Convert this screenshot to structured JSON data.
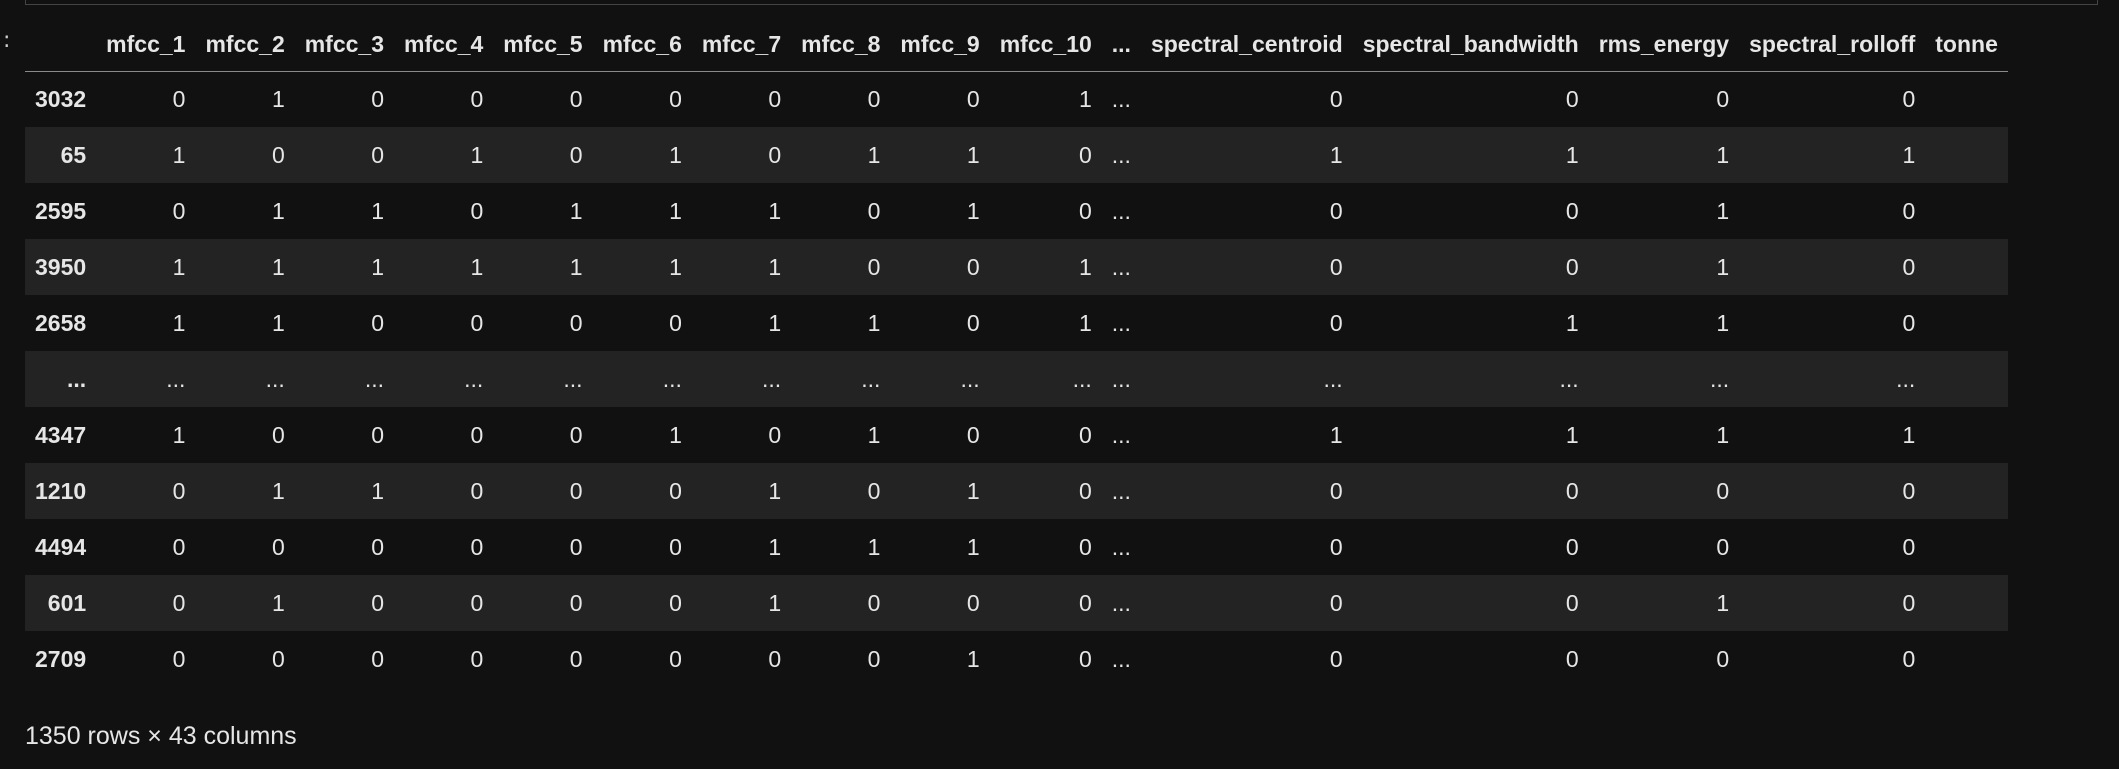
{
  "prompt_mark": ":",
  "table": {
    "columns": [
      "",
      "mfcc_1",
      "mfcc_2",
      "mfcc_3",
      "mfcc_4",
      "mfcc_5",
      "mfcc_6",
      "mfcc_7",
      "mfcc_8",
      "mfcc_9",
      "mfcc_10",
      "...",
      "spectral_centroid",
      "spectral_bandwidth",
      "rms_energy",
      "spectral_rolloff",
      "tonne"
    ],
    "rows": [
      {
        "index": "3032",
        "cells": [
          "0",
          "1",
          "0",
          "0",
          "0",
          "0",
          "0",
          "0",
          "0",
          "1",
          "...",
          "0",
          "0",
          "0",
          "0",
          ""
        ]
      },
      {
        "index": "65",
        "cells": [
          "1",
          "0",
          "0",
          "1",
          "0",
          "1",
          "0",
          "1",
          "1",
          "0",
          "...",
          "1",
          "1",
          "1",
          "1",
          ""
        ]
      },
      {
        "index": "2595",
        "cells": [
          "0",
          "1",
          "1",
          "0",
          "1",
          "1",
          "1",
          "0",
          "1",
          "0",
          "...",
          "0",
          "0",
          "1",
          "0",
          ""
        ]
      },
      {
        "index": "3950",
        "cells": [
          "1",
          "1",
          "1",
          "1",
          "1",
          "1",
          "1",
          "0",
          "0",
          "1",
          "...",
          "0",
          "0",
          "1",
          "0",
          ""
        ]
      },
      {
        "index": "2658",
        "cells": [
          "1",
          "1",
          "0",
          "0",
          "0",
          "0",
          "1",
          "1",
          "0",
          "1",
          "...",
          "0",
          "1",
          "1",
          "0",
          ""
        ]
      },
      {
        "index": "...",
        "cells": [
          "...",
          "...",
          "...",
          "...",
          "...",
          "...",
          "...",
          "...",
          "...",
          "...",
          "...",
          "...",
          "...",
          "...",
          "...",
          ""
        ]
      },
      {
        "index": "4347",
        "cells": [
          "1",
          "0",
          "0",
          "0",
          "0",
          "1",
          "0",
          "1",
          "0",
          "0",
          "...",
          "1",
          "1",
          "1",
          "1",
          ""
        ]
      },
      {
        "index": "1210",
        "cells": [
          "0",
          "1",
          "1",
          "0",
          "0",
          "0",
          "1",
          "0",
          "1",
          "0",
          "...",
          "0",
          "0",
          "0",
          "0",
          ""
        ]
      },
      {
        "index": "4494",
        "cells": [
          "0",
          "0",
          "0",
          "0",
          "0",
          "0",
          "1",
          "1",
          "1",
          "0",
          "...",
          "0",
          "0",
          "0",
          "0",
          ""
        ]
      },
      {
        "index": "601",
        "cells": [
          "0",
          "1",
          "0",
          "0",
          "0",
          "0",
          "1",
          "0",
          "0",
          "0",
          "...",
          "0",
          "0",
          "1",
          "0",
          ""
        ]
      },
      {
        "index": "2709",
        "cells": [
          "0",
          "0",
          "0",
          "0",
          "0",
          "0",
          "0",
          "0",
          "1",
          "0",
          "...",
          "0",
          "0",
          "0",
          "0",
          ""
        ]
      }
    ]
  },
  "footer": "1350 rows × 43 columns"
}
